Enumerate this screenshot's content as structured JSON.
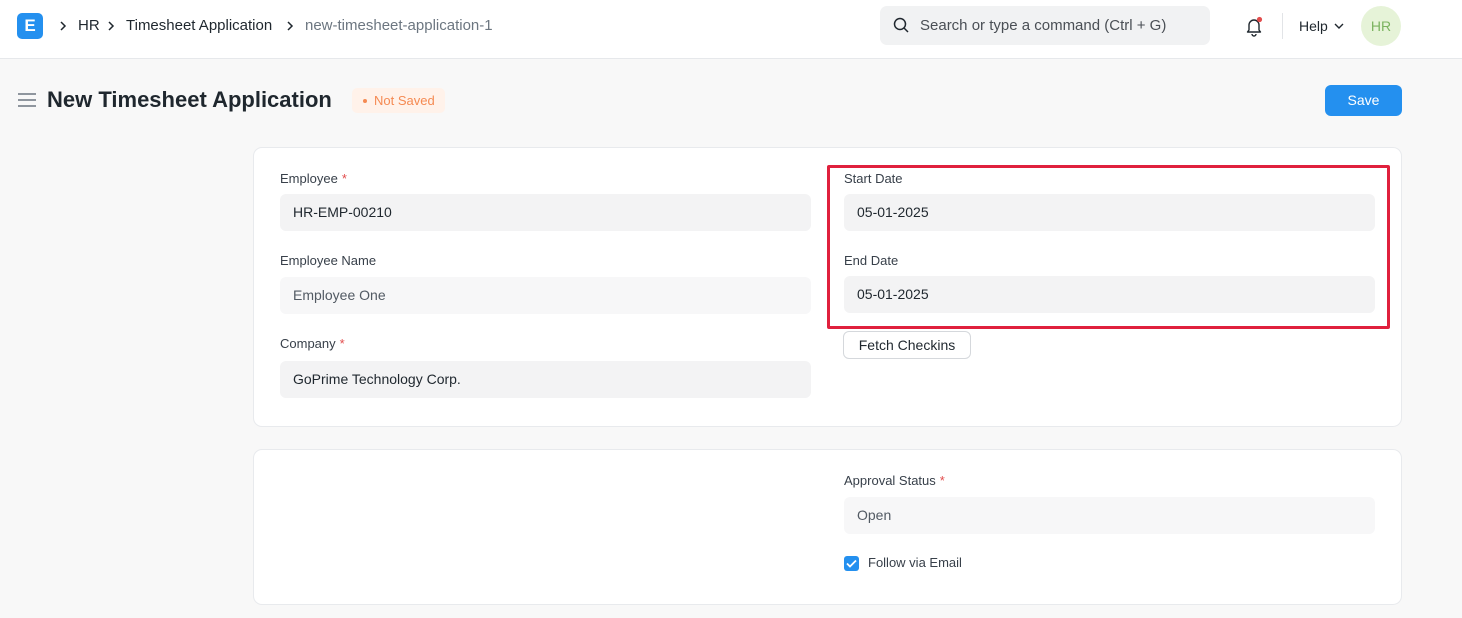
{
  "navbar": {
    "logo_letter": "E",
    "breadcrumbs": [
      "HR",
      "Timesheet Application",
      "new-timesheet-application-1"
    ],
    "search_placeholder": "Search or type a command (Ctrl + G)",
    "help_label": "Help",
    "avatar_initials": "HR"
  },
  "page": {
    "title": "New Timesheet Application",
    "status": "Not Saved",
    "save_label": "Save"
  },
  "form": {
    "employee": {
      "label": "Employee",
      "required": "*",
      "value": "HR-EMP-00210"
    },
    "employee_name": {
      "label": "Employee Name",
      "value": "Employee One"
    },
    "company": {
      "label": "Company",
      "required": "*",
      "value": "GoPrime Technology Corp."
    },
    "start_date": {
      "label": "Start Date",
      "value": "05-01-2025"
    },
    "end_date": {
      "label": "End Date",
      "value": "05-01-2025"
    },
    "fetch_checkins_label": "Fetch Checkins",
    "approval_status": {
      "label": "Approval Status",
      "required": "*",
      "value": "Open"
    },
    "follow_via_email": {
      "label": "Follow via Email",
      "checked": true
    }
  },
  "colors": {
    "primary": "#2490ef",
    "status_orange": "#f58a52",
    "highlight_red": "#e0203d"
  }
}
